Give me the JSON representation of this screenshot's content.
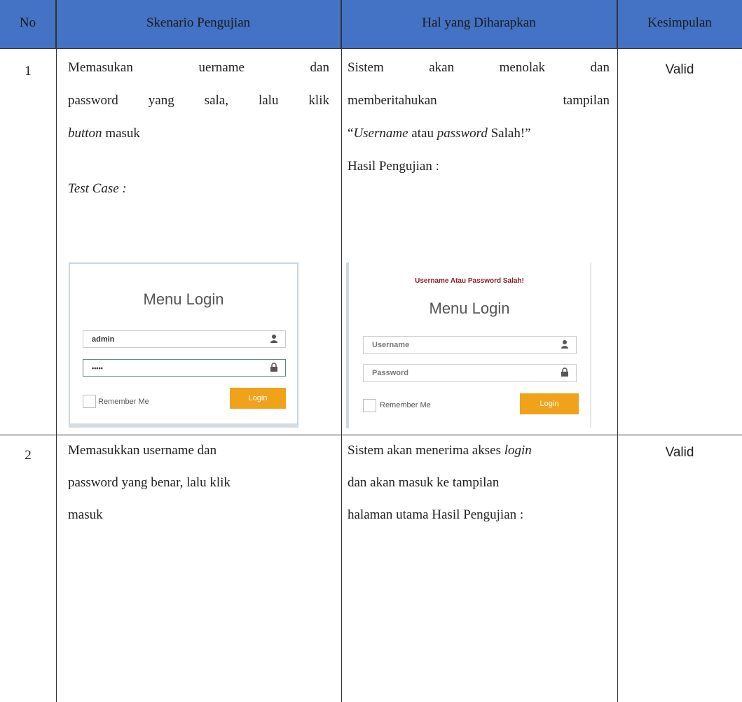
{
  "headers": {
    "no": "No",
    "scenario": "Skenario Pengujian",
    "expected": "Hal yang Diharapkan",
    "conclusion": "Kesimpulan"
  },
  "rows": [
    {
      "no": "1",
      "scenario_lines": [
        "Memasukan uername dan",
        "password yang sala, lalu klik",
        "button masuk"
      ],
      "scenario_testcase": "Test Case :",
      "expected_lines": [
        "Sistem akan menolak dan",
        "memberitahukan tampilan",
        "“Username atau password Salah!”",
        "Hasil Pengujian :"
      ],
      "conclusion": "Valid"
    },
    {
      "no": "2",
      "scenario_lines": [
        "Memasukkan username dan",
        "password yang benar, lalu klik",
        "masuk"
      ],
      "expected_lines": [
        "Sistem akan menerima akses login",
        "dan akan masuk ke tampilan",
        "halaman utama Hasil Pengujian :"
      ],
      "conclusion": "Valid"
    }
  ],
  "login_before": {
    "title": "Menu Login",
    "username_value": "admin",
    "password_value": "•••••",
    "remember_label": "Remember Me",
    "login_button": "Login"
  },
  "login_after": {
    "error": "Username Atau Password Salah!",
    "title": "Menu Login",
    "username_placeholder": "Username",
    "password_placeholder": "Password",
    "remember_label": "Remember Me",
    "login_button": "Login"
  },
  "colors": {
    "header_bg": "#4472c4",
    "login_button": "#f0a21a",
    "error_text": "#8b1e1e"
  }
}
